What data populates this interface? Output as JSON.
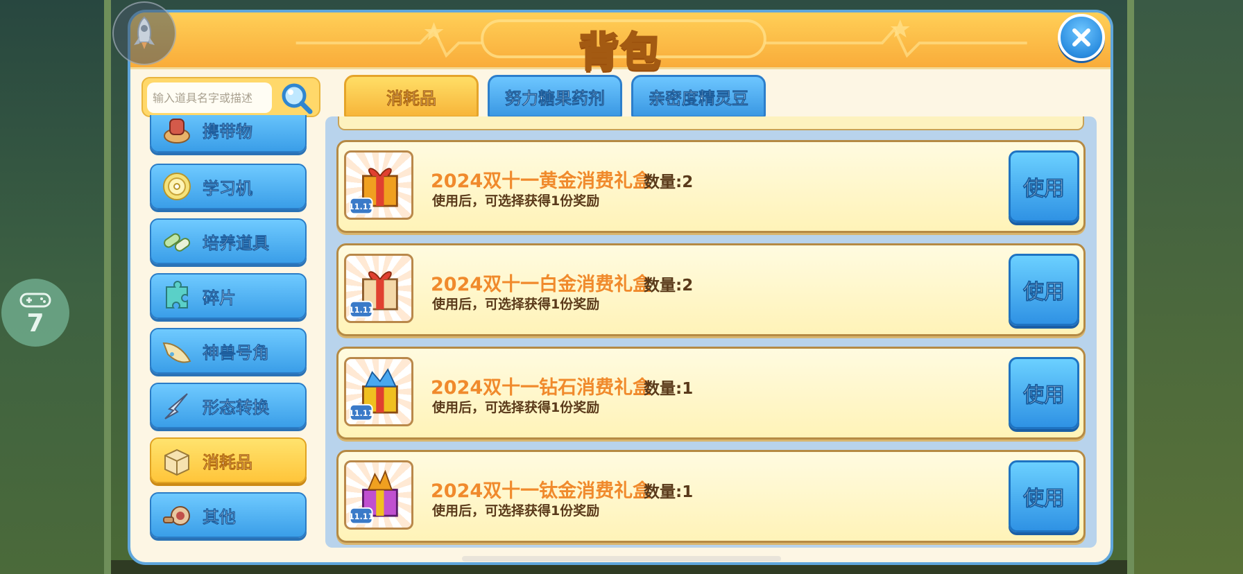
{
  "window": {
    "title": "背包"
  },
  "search": {
    "placeholder": "输入道具名字或描述"
  },
  "sidebar": {
    "items": [
      {
        "label": "携带物",
        "icon": "gear-hat-icon"
      },
      {
        "label": "学习机",
        "icon": "disc-icon"
      },
      {
        "label": "培养道具",
        "icon": "capsule-icon"
      },
      {
        "label": "碎片",
        "icon": "puzzle-icon"
      },
      {
        "label": "神兽号角",
        "icon": "horn-icon"
      },
      {
        "label": "形态转换",
        "icon": "arrow-icon"
      },
      {
        "label": "消耗品",
        "icon": "box-icon",
        "active": true
      },
      {
        "label": "其他",
        "icon": "whistle-icon"
      }
    ]
  },
  "tabs": [
    {
      "label": "消耗品",
      "active": true
    },
    {
      "label": "努力糖果药剂",
      "active": false
    },
    {
      "label": "亲密度精灵豆",
      "active": false
    }
  ],
  "items": [
    {
      "name": "2024双十一黄金消费礼盒",
      "qty": "数量:2",
      "desc": "使用后，可选择获得1份奖励",
      "button": "使用",
      "color": "#f0a020"
    },
    {
      "name": "2024双十一白金消费礼盒",
      "qty": "数量:2",
      "desc": "使用后，可选择获得1份奖励",
      "button": "使用",
      "color": "#e8c890"
    },
    {
      "name": "2024双十一钻石消费礼盒",
      "qty": "数量:1",
      "desc": "使用后，可选择获得1份奖励",
      "button": "使用",
      "color": "#4aa8f0"
    },
    {
      "name": "2024双十一钛金消费礼盒",
      "qty": "数量:1",
      "desc": "使用后，可选择获得1份奖励",
      "button": "使用",
      "color": "#c050d0"
    }
  ],
  "badge_text": "11.11",
  "gamepad_label": "7",
  "colors": {
    "accent_blue": "#3a9ee8",
    "accent_orange": "#f7b53a",
    "item_name": "#f08a2c"
  }
}
